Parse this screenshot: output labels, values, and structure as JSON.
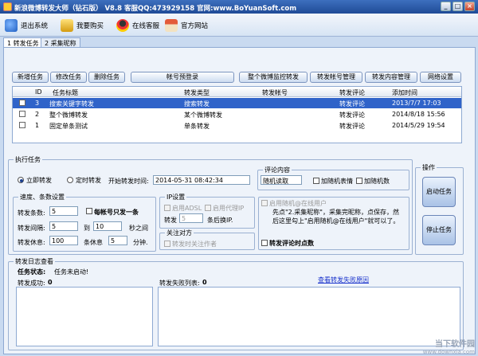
{
  "window": {
    "title": "新浪微博转发大师（钻石版） V8.8 客服QQ:473929158 官网:www.BoYuanSoft.com",
    "minimize": "_",
    "maximize": "□",
    "close": "×"
  },
  "toolbar": {
    "exit": "退出系统",
    "buy": "我要购买",
    "service": "在线客服",
    "website": "官方网站"
  },
  "tabs": [
    {
      "label": "1 转发任务"
    },
    {
      "label": "2 采集昵称"
    }
  ],
  "task_buttons": {
    "add": "新增任务",
    "edit": "修改任务",
    "delete": "删除任务",
    "account_login": "帐号预登录",
    "monitor": "整个微博监控转发",
    "account_manage": "转发帐号管理",
    "content_manage": "转发内容管理",
    "network": "网络设置"
  },
  "task_list": {
    "columns": [
      "ID",
      "任务标题",
      "转发类型",
      "转发帐号",
      "转发评论",
      "添加时间"
    ],
    "rows": [
      {
        "id": "3",
        "title": "搜索关键字转发",
        "type": "搜索转发",
        "account": "",
        "comment": "转发评论",
        "time": "2013/7/7 17:03"
      },
      {
        "id": "2",
        "title": "整个微博转发",
        "type": "某个微博转发",
        "account": "",
        "comment": "转发评论",
        "time": "2014/8/18 15:56"
      },
      {
        "id": "1",
        "title": "固定单条测试",
        "type": "单条转发",
        "account": "",
        "comment": "转发评论",
        "time": "2014/5/29 19:54"
      }
    ]
  },
  "execute": {
    "group_label": "执行任务",
    "immediate": "立即转发",
    "scheduled": "定时转发",
    "start_time_label": "开始转发时间:",
    "start_time_value": "2014-05-31 08:42:34",
    "comment_group": "评论内容",
    "comment_mode": "随机读取",
    "random_emoticon": "加随机表情",
    "random_number": "加随机数"
  },
  "speed": {
    "group_label": "速度、条数设置",
    "count_label": "转发条数:",
    "count_value": "5",
    "per_account_label": "每帐号只发一条",
    "interval_label": "转发间隔:",
    "interval_from": "5",
    "interval_to_label": "到",
    "interval_to": "10",
    "interval_unit": "秒之间",
    "rest_label": "转发休息:",
    "rest_count": "100",
    "rest_mid": "条休息",
    "rest_minutes": "5",
    "rest_unit": "分钟."
  },
  "ip": {
    "group_label": "IP设置",
    "adsl": "启用ADSL",
    "proxy": "启用代理IP",
    "forward_label": "转发",
    "forward_value": "5",
    "forward_unit": "条后换IP."
  },
  "follow": {
    "group_label": "关注对方",
    "follow_author": "转发时关注作者"
  },
  "random_user": {
    "enable": "启用随机@在线用户",
    "hint": "先点\"2.采集昵称\"，采集完昵称，点保存，然后这里勾上\"启用随机@在线用户\"就可以了。",
    "comment_points": "转发评论时点数"
  },
  "operation": {
    "group_label": "操作",
    "start": "启动任务",
    "stop": "停止任务"
  },
  "log": {
    "group_label": "转发日志查看",
    "status_label": "任务状态:",
    "status_value": "任务未启动!",
    "success_label": "转发成功:",
    "success_value": "0",
    "fail_label": "转发失败列表:",
    "fail_value": "0",
    "view_fail_link": "查看转发失败原因"
  },
  "watermark": {
    "brand": "当下软件园",
    "url": "www.downxia.com"
  }
}
